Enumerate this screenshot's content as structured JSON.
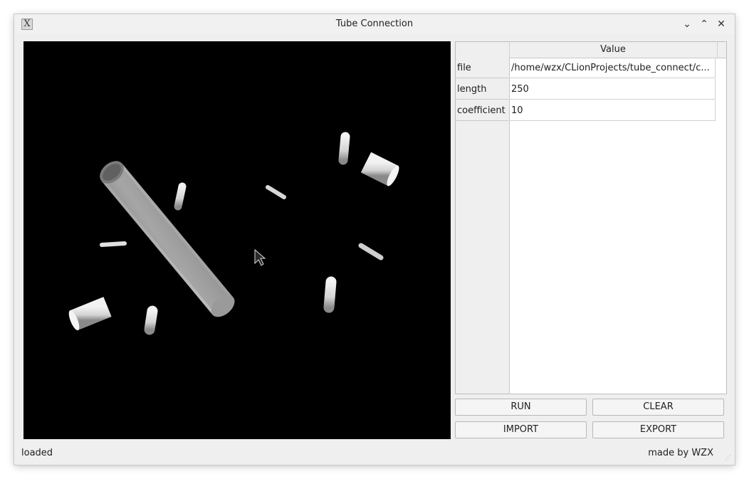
{
  "window": {
    "title": "Tube Connection",
    "app_icon_glyph": "X",
    "controls": {
      "minimize": "⌄",
      "maximize": "⌃",
      "close": "✕"
    }
  },
  "viewport": {
    "background": "#000000",
    "cursor": "arrow"
  },
  "table": {
    "column_header": "Value",
    "rows": [
      {
        "label": "file",
        "value": "/home/wzx/CLionProjects/tube_connect/c..."
      },
      {
        "label": "length",
        "value": "250"
      },
      {
        "label": "coefficient",
        "value": "10"
      }
    ]
  },
  "buttons": {
    "run": "RUN",
    "clear": "CLEAR",
    "import": "IMPORT",
    "export": "EXPORT"
  },
  "status": {
    "left": "loaded",
    "right": "made by WZX"
  }
}
